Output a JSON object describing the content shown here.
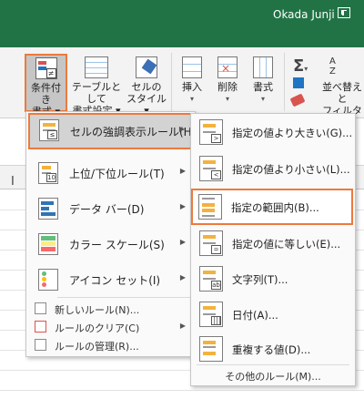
{
  "titlebar": {
    "user": "Okada Junji",
    "ribbon_display_icon": "ribbon-display-options-icon",
    "bg": "#217346"
  },
  "ribbon": {
    "cond_format": {
      "line1": "条件付き",
      "line2": "書式 ▾",
      "icon": "conditional-format-icon"
    },
    "format_table": {
      "line1": "テーブルとして",
      "line2": "書式設定 ▾",
      "icon": "table-format-icon"
    },
    "cell_style": {
      "line1": "セルの",
      "line2": "スタイル ▾",
      "icon": "cell-style-icon"
    },
    "insert": {
      "label": "挿入",
      "caret": "▾",
      "icon": "insert-cells-icon"
    },
    "delete": {
      "label": "削除",
      "caret": "▾",
      "icon": "delete-cells-icon"
    },
    "format": {
      "label": "書式",
      "caret": "▾",
      "icon": "format-cells-icon"
    },
    "autosum": {
      "symbol": "Σ",
      "caret": "▾"
    },
    "sort": {
      "line1": "並べ替えと",
      "line2": "フィルター ▾",
      "icon": "sort-filter-icon"
    }
  },
  "sheet": {
    "fx_fragment": "I"
  },
  "menu": {
    "items": [
      {
        "label": "セルの強調表示ルール(H)",
        "icon": "highlight-cells-rules-icon",
        "arrow": "▶"
      },
      {
        "label": "上位/下位ルール(T)",
        "icon": "top-bottom-rules-icon",
        "arrow": "▶"
      },
      {
        "label": "データ バー(D)",
        "icon": "data-bars-icon",
        "arrow": "▶"
      },
      {
        "label": "カラー スケール(S)",
        "icon": "color-scales-icon",
        "arrow": "▶"
      },
      {
        "label": "アイコン セット(I)",
        "icon": "icon-sets-icon",
        "arrow": "▶"
      }
    ],
    "small_items": [
      {
        "label": "新しいルール(N)...",
        "icon": "new-rule-icon"
      },
      {
        "label": "ルールのクリア(C)",
        "icon": "clear-rules-icon",
        "arrow": "▶"
      },
      {
        "label": "ルールの管理(R)...",
        "icon": "manage-rules-icon"
      }
    ]
  },
  "submenu": {
    "items": [
      {
        "label": "指定の値より大きい(G)...",
        "icon": "greater-than-icon",
        "glyph": ">"
      },
      {
        "label": "指定の値より小さい(L)...",
        "icon": "less-than-icon",
        "glyph": "<"
      },
      {
        "label": "指定の範囲内(B)...",
        "icon": "between-icon",
        "glyph": ""
      },
      {
        "label": "指定の値に等しい(E)...",
        "icon": "equal-to-icon",
        "glyph": "="
      },
      {
        "label": "文字列(T)...",
        "icon": "text-contains-icon",
        "glyph": "ab"
      },
      {
        "label": "日付(A)...",
        "icon": "date-occurring-icon",
        "glyph": ""
      },
      {
        "label": "重複する値(D)...",
        "icon": "duplicate-values-icon",
        "glyph": ""
      }
    ],
    "more": "その他のルール(M)..."
  },
  "colors": {
    "accent": "#ec7a3c",
    "excel_green": "#217346",
    "bar_yellow": "#f3b23e"
  }
}
